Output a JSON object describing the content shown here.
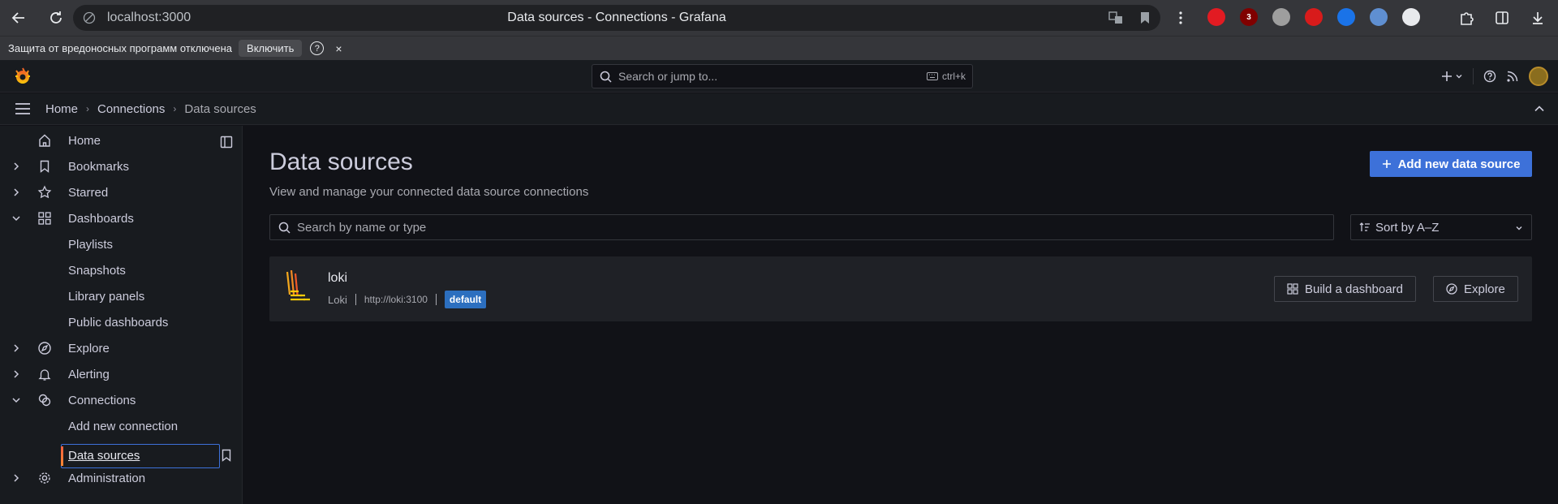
{
  "browser": {
    "url": "localhost:3000",
    "tab_title": "Data sources - Connections - Grafana",
    "extensions": [
      {
        "name": "opera-icon",
        "color": "#e21b22",
        "text": ""
      },
      {
        "name": "ublock-icon",
        "color": "#800000",
        "text": "3"
      },
      {
        "name": "camera-ext-icon",
        "color": "#9e9e9e",
        "text": ""
      },
      {
        "name": "pdf-icon",
        "color": "#d81b1b",
        "text": ""
      },
      {
        "name": "shazam-icon",
        "color": "#1a73e8",
        "text": ""
      },
      {
        "name": "shield-ext-icon",
        "color": "#5f8fd1",
        "text": ""
      },
      {
        "name": "calendar-ext-icon",
        "color": "#e8eaed",
        "text": ""
      }
    ]
  },
  "info_bar": {
    "message": "Защита от вредоносных программ отключена",
    "enable_label": "Включить",
    "help": "?",
    "close": "×"
  },
  "topbar": {
    "search_placeholder": "Search or jump to...",
    "shortcut": "ctrl+k"
  },
  "breadcrumb": {
    "home": "Home",
    "connections": "Connections",
    "data_sources": "Data sources"
  },
  "sidebar": {
    "items": [
      {
        "label": "Home"
      },
      {
        "label": "Bookmarks"
      },
      {
        "label": "Starred"
      },
      {
        "label": "Dashboards"
      },
      {
        "label": "Playlists"
      },
      {
        "label": "Snapshots"
      },
      {
        "label": "Library panels"
      },
      {
        "label": "Public dashboards"
      },
      {
        "label": "Explore"
      },
      {
        "label": "Alerting"
      },
      {
        "label": "Connections"
      },
      {
        "label": "Add new connection"
      },
      {
        "label": "Data sources"
      },
      {
        "label": "Administration"
      }
    ]
  },
  "main": {
    "title": "Data sources",
    "subtitle": "View and manage your connected data source connections",
    "add_button": "Add new data source",
    "search_placeholder": "Search by name or type",
    "sort_label": "Sort by A–Z",
    "datasources": [
      {
        "name": "loki",
        "type": "Loki",
        "url": "http://loki:3100",
        "badge": "default",
        "build_label": "Build a dashboard",
        "explore_label": "Explore"
      }
    ]
  },
  "colors": {
    "accent": "#3d71d9",
    "background": "#111217",
    "panel": "#181b1f",
    "card": "#1f2126",
    "badge": "#2c6fbf"
  }
}
